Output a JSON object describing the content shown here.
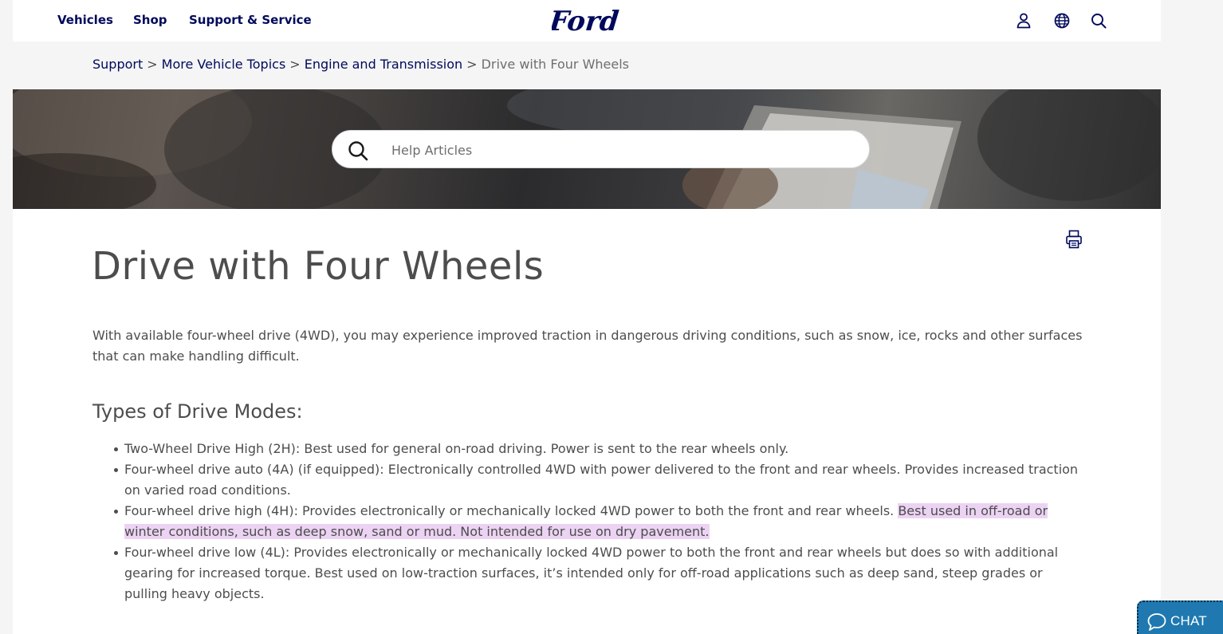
{
  "header": {
    "nav": [
      "Vehicles",
      "Shop",
      "Support & Service"
    ],
    "logo_text": "Ford",
    "icons": [
      "account-icon",
      "globe-icon",
      "search-icon"
    ]
  },
  "breadcrumb": {
    "items": [
      "Support",
      "More Vehicle Topics",
      "Engine and Transmission"
    ],
    "separator": ">",
    "current": "Drive with Four Wheels"
  },
  "search": {
    "placeholder": "Help Articles"
  },
  "article": {
    "title": "Drive with Four Wheels",
    "intro": "With available four-wheel drive (4WD), you may experience improved traction in dangerous driving conditions, such as snow, ice, rocks and other surfaces that can make handling difficult.",
    "subtitle": "Types of Drive Modes:",
    "modes": [
      {
        "text": "Two-Wheel Drive High (2H): Best used for general on-road driving. Power is sent to the rear wheels only.",
        "highlight": ""
      },
      {
        "text": "Four-wheel drive auto (4A) (if equipped): Electronically controlled 4WD with power delivered to the front and rear wheels. Provides increased traction on varied road conditions.",
        "highlight": ""
      },
      {
        "text": "Four-wheel drive high (4H): Provides electronically or mechanically locked 4WD power to both the front and rear wheels. ",
        "highlight": "Best used in off-road or winter conditions, such as deep snow, sand or mud. Not intended for use on dry pavement."
      },
      {
        "text": "Four-wheel drive low (4L): Provides electronically or mechanically locked 4WD power to both the front and rear wheels but does so with additional gearing for increased torque. Best used on low-traction surfaces, it’s intended only for off-road applications such as deep sand, steep grades or pulling heavy objects.",
        "highlight": ""
      }
    ]
  },
  "chat": {
    "label": "CHAT"
  },
  "colors": {
    "brand_navy": "#00095b",
    "text_gray": "#4d4d4d",
    "highlight": "#ecd3f3",
    "chat_blue": "#1f79b0"
  }
}
